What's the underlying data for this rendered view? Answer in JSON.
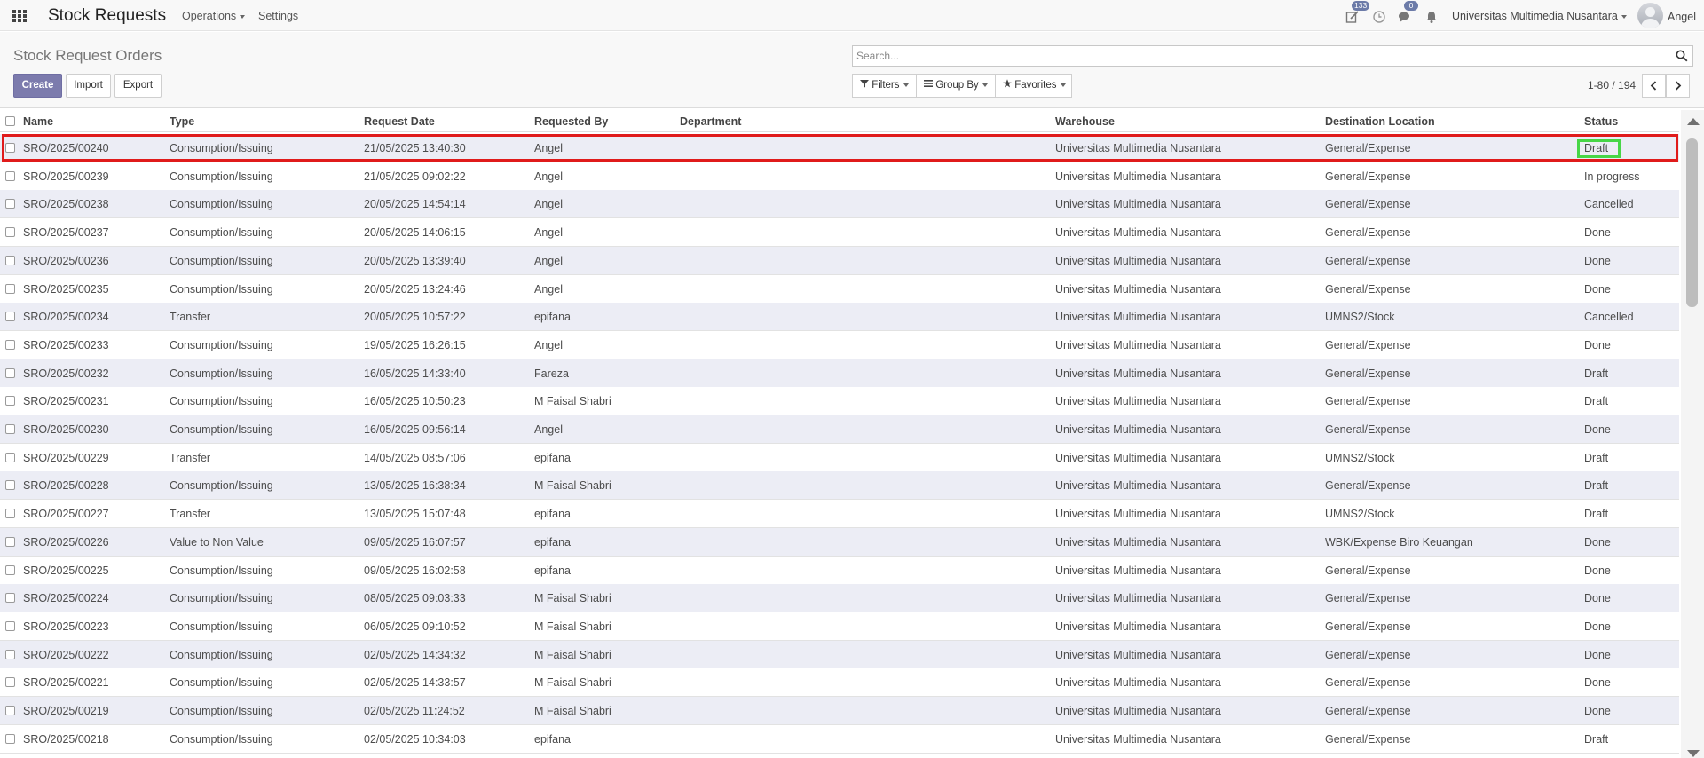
{
  "navbar": {
    "app_title": "Stock Requests",
    "menu_operations": "Operations",
    "menu_settings": "Settings",
    "activity_count": "133",
    "messages_count": "0",
    "company": "Universitas Multimedia Nusantara",
    "user": "Angel",
    "icons": [
      "apps-grid-icon",
      "activity-icon",
      "clock-icon",
      "chat-icon",
      "bell-icon",
      "avatar"
    ]
  },
  "control_panel": {
    "title": "Stock Request Orders",
    "create_label": "Create",
    "import_label": "Import",
    "export_label": "Export",
    "search_placeholder": "Search...",
    "filters_label": "Filters",
    "group_by_label": "Group By",
    "favorites_label": "Favorites",
    "pager_value": "1-80 / 194"
  },
  "colors": {
    "primary_button": "#7c7bad",
    "row_stripe": "#ecedf5",
    "selected_row_outline": "#e01b1b",
    "status_outline": "#47d647"
  },
  "table": {
    "columns": {
      "name": "Name",
      "type": "Type",
      "request_date": "Request Date",
      "requested_by": "Requested By",
      "department": "Department",
      "warehouse": "Warehouse",
      "destination": "Destination Location",
      "status": "Status"
    },
    "rows": [
      {
        "name": "SRO/2025/00240",
        "type": "Consumption/Issuing",
        "date": "21/05/2025 13:40:30",
        "by": "Angel",
        "department": "",
        "warehouse": "Universitas Multimedia Nusantara",
        "destination": "General/Expense",
        "status": "Draft"
      },
      {
        "name": "SRO/2025/00239",
        "type": "Consumption/Issuing",
        "date": "21/05/2025 09:02:22",
        "by": "Angel",
        "department": "",
        "warehouse": "Universitas Multimedia Nusantara",
        "destination": "General/Expense",
        "status": "In progress"
      },
      {
        "name": "SRO/2025/00238",
        "type": "Consumption/Issuing",
        "date": "20/05/2025 14:54:14",
        "by": "Angel",
        "department": "",
        "warehouse": "Universitas Multimedia Nusantara",
        "destination": "General/Expense",
        "status": "Cancelled"
      },
      {
        "name": "SRO/2025/00237",
        "type": "Consumption/Issuing",
        "date": "20/05/2025 14:06:15",
        "by": "Angel",
        "department": "",
        "warehouse": "Universitas Multimedia Nusantara",
        "destination": "General/Expense",
        "status": "Done"
      },
      {
        "name": "SRO/2025/00236",
        "type": "Consumption/Issuing",
        "date": "20/05/2025 13:39:40",
        "by": "Angel",
        "department": "",
        "warehouse": "Universitas Multimedia Nusantara",
        "destination": "General/Expense",
        "status": "Done"
      },
      {
        "name": "SRO/2025/00235",
        "type": "Consumption/Issuing",
        "date": "20/05/2025 13:24:46",
        "by": "Angel",
        "department": "",
        "warehouse": "Universitas Multimedia Nusantara",
        "destination": "General/Expense",
        "status": "Done"
      },
      {
        "name": "SRO/2025/00234",
        "type": "Transfer",
        "date": "20/05/2025 10:57:22",
        "by": "epifana",
        "department": "",
        "warehouse": "Universitas Multimedia Nusantara",
        "destination": "UMNS2/Stock",
        "status": "Cancelled"
      },
      {
        "name": "SRO/2025/00233",
        "type": "Consumption/Issuing",
        "date": "19/05/2025 16:26:15",
        "by": "Angel",
        "department": "",
        "warehouse": "Universitas Multimedia Nusantara",
        "destination": "General/Expense",
        "status": "Done"
      },
      {
        "name": "SRO/2025/00232",
        "type": "Consumption/Issuing",
        "date": "16/05/2025 14:33:40",
        "by": "Fareza",
        "department": "",
        "warehouse": "Universitas Multimedia Nusantara",
        "destination": "General/Expense",
        "status": "Draft"
      },
      {
        "name": "SRO/2025/00231",
        "type": "Consumption/Issuing",
        "date": "16/05/2025 10:50:23",
        "by": "M Faisal Shabri",
        "department": "",
        "warehouse": "Universitas Multimedia Nusantara",
        "destination": "General/Expense",
        "status": "Draft"
      },
      {
        "name": "SRO/2025/00230",
        "type": "Consumption/Issuing",
        "date": "16/05/2025 09:56:14",
        "by": "Angel",
        "department": "",
        "warehouse": "Universitas Multimedia Nusantara",
        "destination": "General/Expense",
        "status": "Done"
      },
      {
        "name": "SRO/2025/00229",
        "type": "Transfer",
        "date": "14/05/2025 08:57:06",
        "by": "epifana",
        "department": "",
        "warehouse": "Universitas Multimedia Nusantara",
        "destination": "UMNS2/Stock",
        "status": "Draft"
      },
      {
        "name": "SRO/2025/00228",
        "type": "Consumption/Issuing",
        "date": "13/05/2025 16:38:34",
        "by": "M Faisal Shabri",
        "department": "",
        "warehouse": "Universitas Multimedia Nusantara",
        "destination": "General/Expense",
        "status": "Draft"
      },
      {
        "name": "SRO/2025/00227",
        "type": "Transfer",
        "date": "13/05/2025 15:07:48",
        "by": "epifana",
        "department": "",
        "warehouse": "Universitas Multimedia Nusantara",
        "destination": "UMNS2/Stock",
        "status": "Draft"
      },
      {
        "name": "SRO/2025/00226",
        "type": "Value to Non Value",
        "date": "09/05/2025 16:07:57",
        "by": "epifana",
        "department": "",
        "warehouse": "Universitas Multimedia Nusantara",
        "destination": "WBK/Expense Biro Keuangan",
        "status": "Done"
      },
      {
        "name": "SRO/2025/00225",
        "type": "Consumption/Issuing",
        "date": "09/05/2025 16:02:58",
        "by": "epifana",
        "department": "",
        "warehouse": "Universitas Multimedia Nusantara",
        "destination": "General/Expense",
        "status": "Done"
      },
      {
        "name": "SRO/2025/00224",
        "type": "Consumption/Issuing",
        "date": "08/05/2025 09:03:33",
        "by": "M Faisal Shabri",
        "department": "",
        "warehouse": "Universitas Multimedia Nusantara",
        "destination": "General/Expense",
        "status": "Done"
      },
      {
        "name": "SRO/2025/00223",
        "type": "Consumption/Issuing",
        "date": "06/05/2025 09:10:52",
        "by": "M Faisal Shabri",
        "department": "",
        "warehouse": "Universitas Multimedia Nusantara",
        "destination": "General/Expense",
        "status": "Done"
      },
      {
        "name": "SRO/2025/00222",
        "type": "Consumption/Issuing",
        "date": "02/05/2025 14:34:32",
        "by": "M Faisal Shabri",
        "department": "",
        "warehouse": "Universitas Multimedia Nusantara",
        "destination": "General/Expense",
        "status": "Done"
      },
      {
        "name": "SRO/2025/00221",
        "type": "Consumption/Issuing",
        "date": "02/05/2025 14:33:57",
        "by": "M Faisal Shabri",
        "department": "",
        "warehouse": "Universitas Multimedia Nusantara",
        "destination": "General/Expense",
        "status": "Done"
      },
      {
        "name": "SRO/2025/00219",
        "type": "Consumption/Issuing",
        "date": "02/05/2025 11:24:52",
        "by": "M Faisal Shabri",
        "department": "",
        "warehouse": "Universitas Multimedia Nusantara",
        "destination": "General/Expense",
        "status": "Done"
      },
      {
        "name": "SRO/2025/00218",
        "type": "Consumption/Issuing",
        "date": "02/05/2025 10:34:03",
        "by": "epifana",
        "department": "",
        "warehouse": "Universitas Multimedia Nusantara",
        "destination": "General/Expense",
        "status": "Draft"
      }
    ]
  }
}
